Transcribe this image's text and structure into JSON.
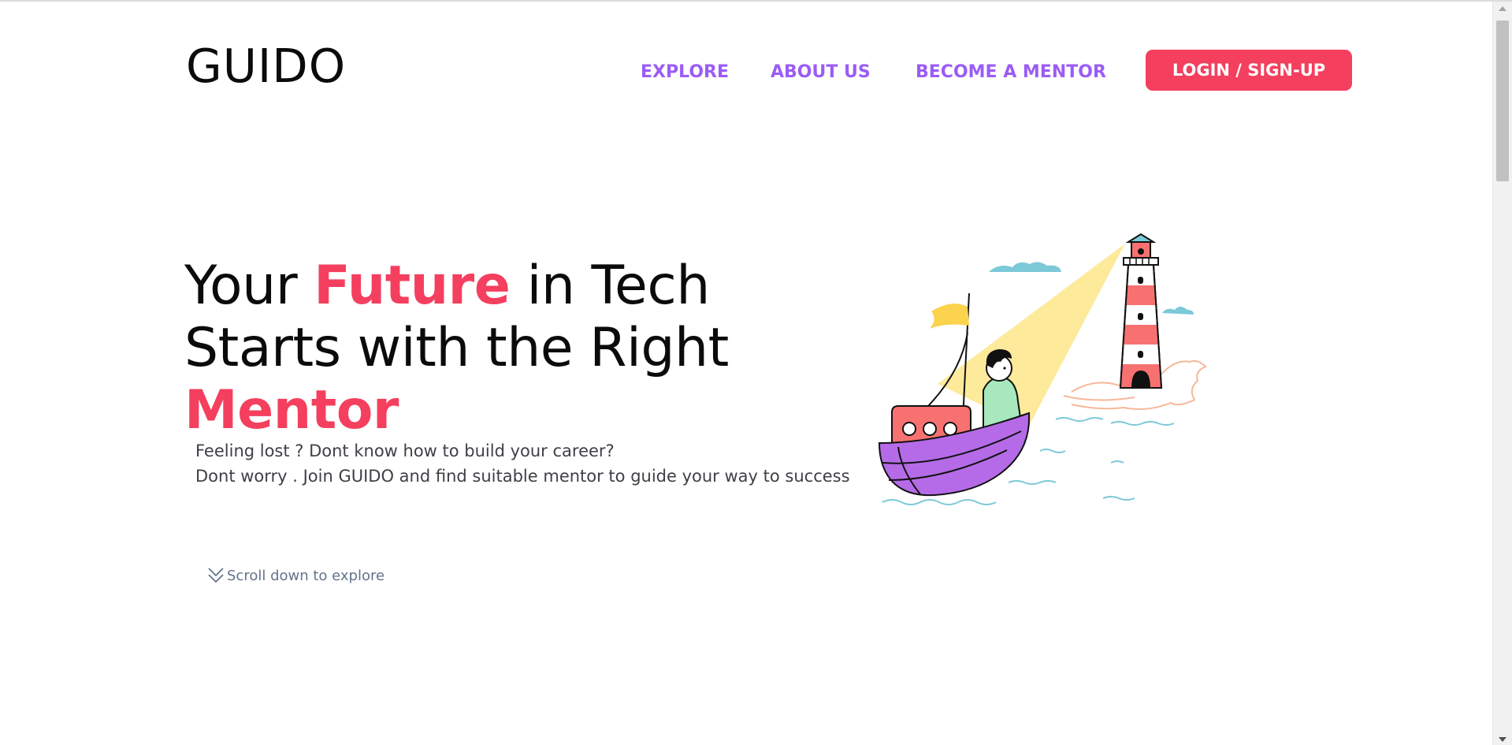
{
  "header": {
    "logo": "GUIDO",
    "nav": [
      {
        "label": "EXPLORE"
      },
      {
        "label": "ABOUT US"
      },
      {
        "label": "BECOME A MENTOR"
      }
    ],
    "login_label": "LOGIN / SIGN-UP"
  },
  "hero": {
    "headline_part1": "Your ",
    "headline_accent1": "Future",
    "headline_part2": " in Tech Starts with the Right ",
    "headline_accent2": "Mentor",
    "description_line1": "Feeling lost ? Dont know how to build your career?",
    "description_line2": "Dont worry . Join GUIDO and find suitable mentor to guide your way to success",
    "scroll_hint": "Scroll down to explore"
  },
  "icons": {
    "scroll": "double-chevron-down-icon",
    "illustration": "boat-lighthouse-illustration"
  },
  "colors": {
    "accent": "#f43f5e",
    "nav": "#9b5cf6",
    "text": "#0b0b0b",
    "muted": "#64748b"
  }
}
